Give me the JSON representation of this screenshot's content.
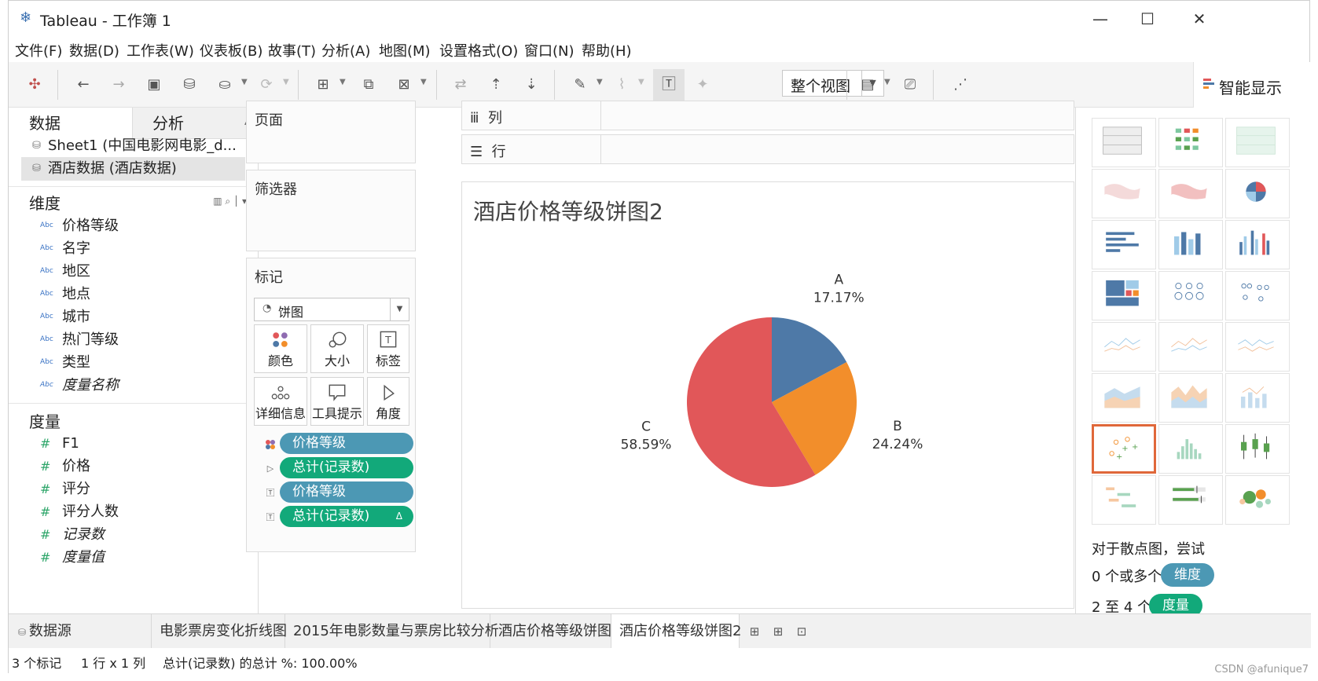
{
  "window": {
    "title": "Tableau - 工作簿 1",
    "minimize": "—",
    "maximize": "☐",
    "close": "✕"
  },
  "menu": [
    "文件(F)",
    "数据(D)",
    "工作表(W)",
    "仪表板(B)",
    "故事(T)",
    "分析(A)",
    "地图(M)",
    "设置格式(O)",
    "窗口(N)",
    "帮助(H)"
  ],
  "toolbar": {
    "fit_view": "整个视图",
    "show_me": "智能显示"
  },
  "data_pane": {
    "tab_data": "数据",
    "tab_analysis": "分析",
    "datasources": [
      "Sheet1 (中国电影网电影_d...",
      "酒店数据 (酒店数据)"
    ],
    "dimensions_title": "维度",
    "dimensions": [
      "价格等级",
      "名字",
      "地区",
      "地点",
      "城市",
      "热门等级",
      "类型",
      "度量名称"
    ],
    "measures_title": "度量",
    "measures": [
      "F1",
      "价格",
      "评分",
      "评分人数",
      "记录数",
      "度量值"
    ]
  },
  "shelves": {
    "pages": "页面",
    "filters": "筛选器",
    "marks": "标记",
    "columns": "列",
    "rows": "行",
    "mark_type": "饼图",
    "mark_buttons": [
      "颜色",
      "大小",
      "标签",
      "详细信息",
      "工具提示",
      "角度"
    ],
    "pills": [
      {
        "text": "价格等级",
        "kind": "dim"
      },
      {
        "text": "总计(记录数)",
        "kind": "meas"
      },
      {
        "text": "价格等级",
        "kind": "dim"
      },
      {
        "text": "总计(记录数)",
        "kind": "meas",
        "tail": "Δ"
      }
    ]
  },
  "viz": {
    "title": "酒店价格等级饼图2"
  },
  "chart_data": {
    "type": "pie",
    "title": "酒店价格等级饼图2",
    "categories": [
      "A",
      "B",
      "C"
    ],
    "values": [
      17.17,
      24.24,
      58.59
    ],
    "labels": [
      "17.17%",
      "24.24%",
      "58.59%"
    ],
    "colors": [
      "#4e79a7",
      "#f28e2b",
      "#e15759"
    ]
  },
  "showme": {
    "hint": "对于散点图，尝试",
    "dims_text": "0 个或多个",
    "dims_badge": "维度",
    "meas_text": "2 至 4 个",
    "meas_badge": "度量"
  },
  "sheets": [
    "数据源",
    "电影票房变化折线图",
    "2015年电影数量与票房比较分析",
    "酒店价格等级饼图",
    "酒店价格等级饼图2"
  ],
  "status": [
    "3 个标记",
    "1 行 x 1 列",
    "总计(记录数) 的总计 %: 100.00%"
  ],
  "watermark": "CSDN @afunique7"
}
